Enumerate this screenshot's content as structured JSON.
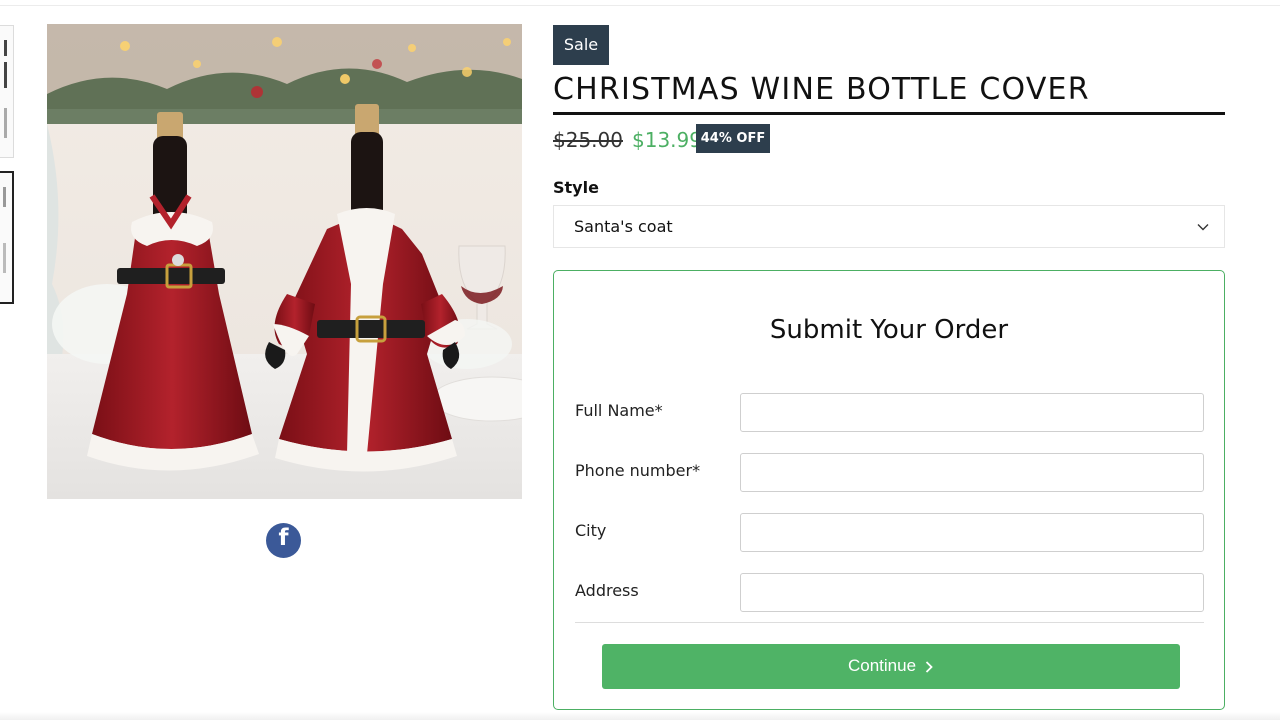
{
  "product": {
    "sale_badge": "Sale",
    "title": "CHRISTMAS WINE BOTTLE COVER",
    "price_original": "$25.00",
    "price_current": "$13.99",
    "discount": "44% OFF",
    "share_icon": "facebook-icon",
    "share_glyph": "f"
  },
  "style": {
    "label": "Style",
    "selected": "Santa's coat"
  },
  "order_form": {
    "title": "Submit Your Order",
    "fields": [
      {
        "label": "Full Name*",
        "value": "",
        "placeholder": ""
      },
      {
        "label": "Phone number*",
        "value": "",
        "placeholder": ""
      },
      {
        "label": "City",
        "value": "",
        "placeholder": ""
      },
      {
        "label": "Address",
        "value": "",
        "placeholder": ""
      }
    ],
    "continue_label": "Continue"
  },
  "colors": {
    "badge_bg": "#2d3e4d",
    "price_green": "#4caf63",
    "button_green": "#4fb366",
    "facebook_blue": "#3b5998"
  }
}
